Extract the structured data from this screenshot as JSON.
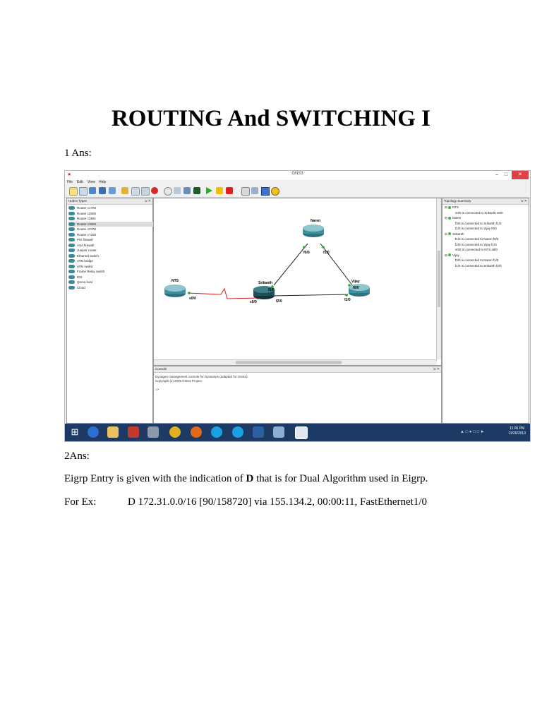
{
  "doc": {
    "title": "ROUTING And SWITCHING I",
    "ans1": "1 Ans:",
    "ans2": "2Ans:",
    "line1_pre": "Eigrp Entry is given with the indication of ",
    "line1_bold": "D",
    "line1_post": " that is for Dual Algorithm used in Eigrp.",
    "forex_label": "For Ex:",
    "forex_value": "D  172.31.0.0/16  [90/158720]  via 155.134.2,  00:00:11,  FastEthernet1/0"
  },
  "screenshot": {
    "window_title": "GNS3",
    "menu": [
      "File",
      "Edit",
      "View",
      "Help"
    ],
    "node_types_title": "Nodes Types",
    "node_types": [
      "Router c1700",
      "Router c2600",
      "Router c2691",
      "Router c3600",
      "Router c3700",
      "Router c7200",
      "PIX firewall",
      "ASA firewall",
      "Juniper router",
      "Ethernet switch",
      "ATM bridge",
      "ATM switch",
      "Frame Relay switch",
      "IDS",
      "Qemu host",
      "Cloud"
    ],
    "selected_node": 3,
    "topology_title": "Topology Summary",
    "topology": [
      {
        "name": "NTS",
        "links": [
          "s0/0 is connected to Srikanth s0/0"
        ]
      },
      {
        "name": "Naren",
        "links": [
          "f0/0 is connected to Srikanth f1/0",
          "f1/0 is connected to Vijay f0/0"
        ]
      },
      {
        "name": "Srikanth",
        "links": [
          "f1/0 is connected to Naren f0/0",
          "f2/0 is connected to Vijay f1/0",
          "s0/0 is connected to NTS s0/0"
        ]
      },
      {
        "name": "Vijay",
        "links": [
          "f0/0 is connected to Naren f1/0",
          "f1/0 is connected to Srikanth f2/0"
        ]
      }
    ],
    "diagram": {
      "routers": [
        "NTS",
        "Naren",
        "Srikanth",
        "Vijay"
      ],
      "labels": [
        "s0/0",
        "s0/0",
        "f0/0",
        "f1/0",
        "f1/0",
        "f2/0",
        "f0/0",
        "f1/0"
      ]
    },
    "console_title": "Console",
    "console_lines": [
      "Dynagen management console for Dynamips (adapted for GNS3)",
      "Copyright (c) 2008 GNS3 Project",
      "=>"
    ],
    "clock_time": "11:06 PM",
    "clock_date": "11/26/2013",
    "colors": {
      "router": "#3f8f9e",
      "router_selected": "#1f4f5a",
      "link": "#222222",
      "serial_link": "#d62020",
      "taskbar": "#1d3a64"
    }
  }
}
